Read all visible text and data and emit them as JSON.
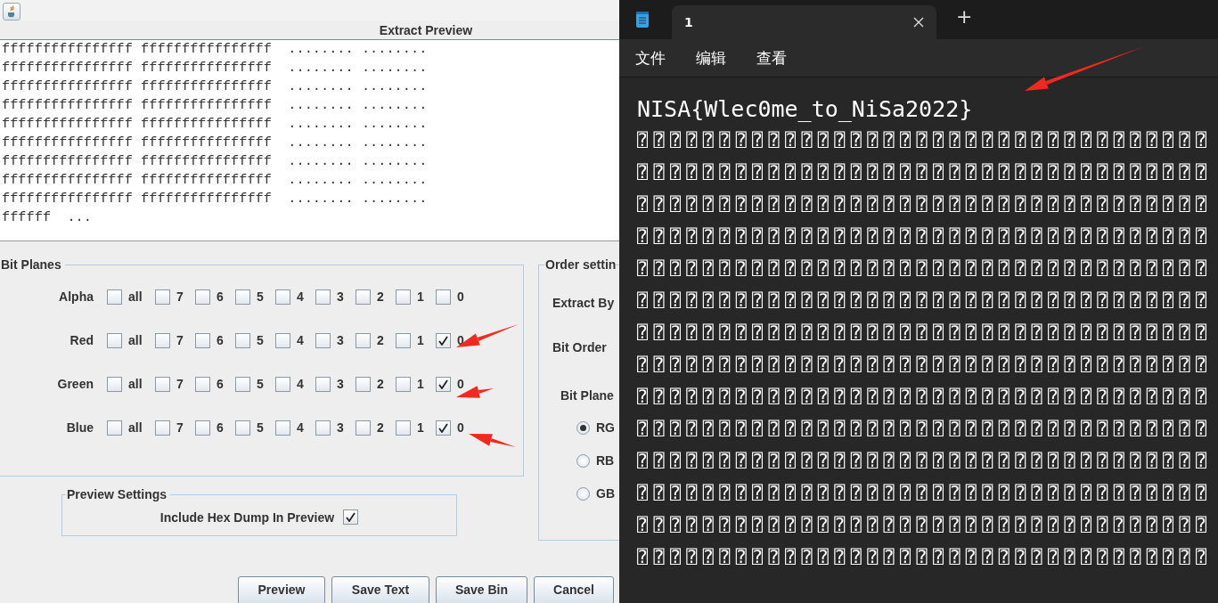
{
  "extract_window": {
    "preview_title": "Extract Preview",
    "hex_lines": [
      "ffffffffffffffff ffffffffffffffff  ........ ........",
      "ffffffffffffffff ffffffffffffffff  ........ ........",
      "ffffffffffffffff ffffffffffffffff  ........ ........",
      "ffffffffffffffff ffffffffffffffff  ........ ........",
      "ffffffffffffffff ffffffffffffffff  ........ ........",
      "ffffffffffffffff ffffffffffffffff  ........ ........",
      "ffffffffffffffff ffffffffffffffff  ........ ........",
      "ffffffffffffffff ffffffffffffffff  ........ ........",
      "ffffffffffffffff ffffffffffffffff  ........ ........",
      "ffffff  ..."
    ],
    "bit_planes": {
      "title": "Bit Planes",
      "rows": [
        {
          "label": "Alpha",
          "options": [
            {
              "label": "all",
              "checked": false
            },
            {
              "label": "7",
              "checked": false
            },
            {
              "label": "6",
              "checked": false
            },
            {
              "label": "5",
              "checked": false
            },
            {
              "label": "4",
              "checked": false
            },
            {
              "label": "3",
              "checked": false
            },
            {
              "label": "2",
              "checked": false
            },
            {
              "label": "1",
              "checked": false
            },
            {
              "label": "0",
              "checked": false
            }
          ]
        },
        {
          "label": "Red",
          "options": [
            {
              "label": "all",
              "checked": false
            },
            {
              "label": "7",
              "checked": false
            },
            {
              "label": "6",
              "checked": false
            },
            {
              "label": "5",
              "checked": false
            },
            {
              "label": "4",
              "checked": false
            },
            {
              "label": "3",
              "checked": false
            },
            {
              "label": "2",
              "checked": false
            },
            {
              "label": "1",
              "checked": false
            },
            {
              "label": "0",
              "checked": true
            }
          ]
        },
        {
          "label": "Green",
          "options": [
            {
              "label": "all",
              "checked": false
            },
            {
              "label": "7",
              "checked": false
            },
            {
              "label": "6",
              "checked": false
            },
            {
              "label": "5",
              "checked": false
            },
            {
              "label": "4",
              "checked": false
            },
            {
              "label": "3",
              "checked": false
            },
            {
              "label": "2",
              "checked": false
            },
            {
              "label": "1",
              "checked": false
            },
            {
              "label": "0",
              "checked": true
            }
          ]
        },
        {
          "label": "Blue",
          "options": [
            {
              "label": "all",
              "checked": false
            },
            {
              "label": "7",
              "checked": false
            },
            {
              "label": "6",
              "checked": false
            },
            {
              "label": "5",
              "checked": false
            },
            {
              "label": "4",
              "checked": false
            },
            {
              "label": "3",
              "checked": false
            },
            {
              "label": "2",
              "checked": false
            },
            {
              "label": "1",
              "checked": false
            },
            {
              "label": "0",
              "checked": true
            }
          ]
        }
      ]
    },
    "preview_settings": {
      "title": "Preview Settings",
      "label": "Include Hex Dump In Preview",
      "checked": true
    },
    "order_settings": {
      "title": "Order settin",
      "fields": [
        "Extract By",
        "Bit Order"
      ],
      "bit_plane_order": {
        "label": "Bit Plane",
        "options": [
          {
            "label": "RG",
            "selected": true
          },
          {
            "label": "RB",
            "selected": false
          },
          {
            "label": "GB",
            "selected": false
          }
        ]
      }
    },
    "buttons": [
      "Preview",
      "Save Text",
      "Save Bin",
      "Cancel"
    ]
  },
  "notepad": {
    "tabs": [
      {
        "title": "1",
        "selected": true
      }
    ],
    "new_tab": "+",
    "menu": [
      "文件",
      "编辑",
      "查看"
    ],
    "lines": [
      "NISA{Wlec0me_to_NiSa2022}",
      "⍰⍰⍰⍰⍰⍰⍰⍰⍰⍰⍰⍰⍰⍰⍰⍰⍰⍰⍰⍰⍰⍰⍰⍰⍰⍰⍰⍰⍰⍰⍰⍰⍰⍰⍰",
      "⍰⍰⍰⍰⍰⍰⍰⍰⍰⍰⍰⍰⍰⍰⍰⍰⍰⍰⍰⍰⍰⍰⍰⍰⍰⍰⍰⍰⍰⍰⍰⍰⍰⍰⍰",
      "⍰⍰⍰⍰⍰⍰⍰⍰⍰⍰⍰⍰⍰⍰⍰⍰⍰⍰⍰⍰⍰⍰⍰⍰⍰⍰⍰⍰⍰⍰⍰⍰⍰⍰⍰",
      "⍰⍰⍰⍰⍰⍰⍰⍰⍰⍰⍰⍰⍰⍰⍰⍰⍰⍰⍰⍰⍰⍰⍰⍰⍰⍰⍰⍰⍰⍰⍰⍰⍰⍰⍰",
      "⍰⍰⍰⍰⍰⍰⍰⍰⍰⍰⍰⍰⍰⍰⍰⍰⍰⍰⍰⍰⍰⍰⍰⍰⍰⍰⍰⍰⍰⍰⍰⍰⍰⍰⍰",
      "⍰⍰⍰⍰⍰⍰⍰⍰⍰⍰⍰⍰⍰⍰⍰⍰⍰⍰⍰⍰⍰⍰⍰⍰⍰⍰⍰⍰⍰⍰⍰⍰⍰⍰⍰",
      "⍰⍰⍰⍰⍰⍰⍰⍰⍰⍰⍰⍰⍰⍰⍰⍰⍰⍰⍰⍰⍰⍰⍰⍰⍰⍰⍰⍰⍰⍰⍰⍰⍰⍰⍰",
      "⍰⍰⍰⍰⍰⍰⍰⍰⍰⍰⍰⍰⍰⍰⍰⍰⍰⍰⍰⍰⍰⍰⍰⍰⍰⍰⍰⍰⍰⍰⍰⍰⍰⍰⍰",
      "⍰⍰⍰⍰⍰⍰⍰⍰⍰⍰⍰⍰⍰⍰⍰⍰⍰⍰⍰⍰⍰⍰⍰⍰⍰⍰⍰⍰⍰⍰⍰⍰⍰⍰⍰",
      "⍰⍰⍰⍰⍰⍰⍰⍰⍰⍰⍰⍰⍰⍰⍰⍰⍰⍰⍰⍰⍰⍰⍰⍰⍰⍰⍰⍰⍰⍰⍰⍰⍰⍰⍰",
      "⍰⍰⍰⍰⍰⍰⍰⍰⍰⍰⍰⍰⍰⍰⍰⍰⍰⍰⍰⍰⍰⍰⍰⍰⍰⍰⍰⍰⍰⍰⍰⍰⍰⍰⍰",
      "⍰⍰⍰⍰⍰⍰⍰⍰⍰⍰⍰⍰⍰⍰⍰⍰⍰⍰⍰⍰⍰⍰⍰⍰⍰⍰⍰⍰⍰⍰⍰⍰⍰⍰⍰",
      "⍰⍰⍰⍰⍰⍰⍰⍰⍰⍰⍰⍰⍰⍰⍰⍰⍰⍰⍰⍰⍰⍰⍰⍰⍰⍰⍰⍰⍰⍰⍰⍰⍰⍰⍰",
      "⍰⍰⍰⍰⍰⍰⍰⍰⍰⍰⍰⍰⍰⍰⍰⍰⍰⍰⍰⍰⍰⍰⍰⍰⍰⍰⍰⍰⍰⍰⍰⍰⍰⍰⍰"
    ]
  }
}
